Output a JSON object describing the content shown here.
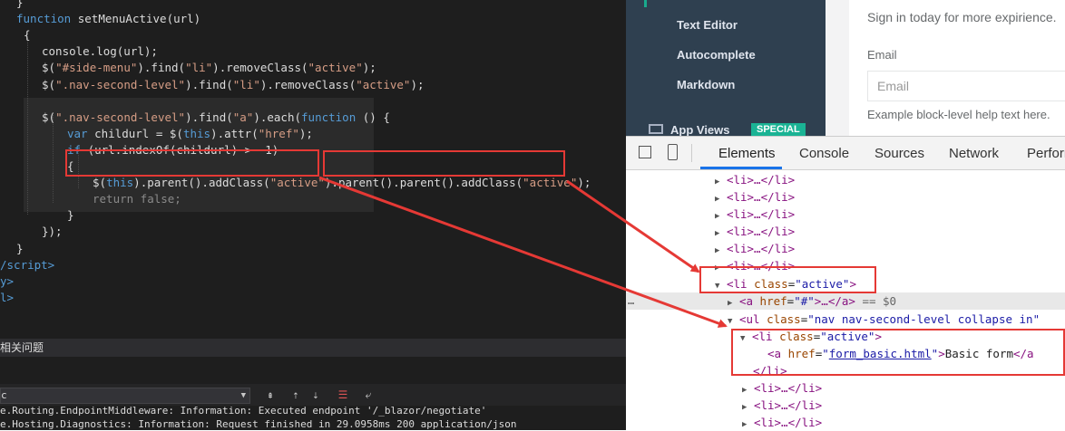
{
  "editor": {
    "code_lines": [
      {
        "indent": 18,
        "parts": [
          {
            "t": "}",
            "c": ""
          }
        ]
      },
      {
        "indent": 18,
        "parts": [
          {
            "t": "function",
            "c": "kw"
          },
          {
            "t": " setMenuActive(url)",
            "c": ""
          }
        ]
      },
      {
        "indent": 26,
        "parts": [
          {
            "t": "{",
            "c": ""
          }
        ]
      },
      {
        "indent": 46,
        "parts": [
          {
            "t": "console.log(url);",
            "c": ""
          }
        ]
      },
      {
        "indent": 46,
        "parts": [
          {
            "t": "$(",
            "c": ""
          },
          {
            "t": "\"#side-menu\"",
            "c": "str"
          },
          {
            "t": ").find(",
            "c": ""
          },
          {
            "t": "\"li\"",
            "c": "str"
          },
          {
            "t": ").removeClass(",
            "c": ""
          },
          {
            "t": "\"active\"",
            "c": "str"
          },
          {
            "t": ");",
            "c": ""
          }
        ]
      },
      {
        "indent": 46,
        "parts": [
          {
            "t": "$(",
            "c": ""
          },
          {
            "t": "\".nav-second-level\"",
            "c": "str"
          },
          {
            "t": ").find(",
            "c": ""
          },
          {
            "t": "\"li\"",
            "c": "str"
          },
          {
            "t": ").removeClass(",
            "c": ""
          },
          {
            "t": "\"active\"",
            "c": "str"
          },
          {
            "t": ");",
            "c": ""
          }
        ]
      },
      {
        "indent": 46,
        "parts": []
      },
      {
        "indent": 46,
        "parts": [
          {
            "t": "$(",
            "c": ""
          },
          {
            "t": "\".nav-second-level\"",
            "c": "str"
          },
          {
            "t": ").find(",
            "c": ""
          },
          {
            "t": "\"a\"",
            "c": "str"
          },
          {
            "t": ").each(",
            "c": ""
          },
          {
            "t": "function",
            "c": "kw"
          },
          {
            "t": " () {",
            "c": ""
          }
        ]
      },
      {
        "indent": 74,
        "parts": [
          {
            "t": "var",
            "c": "kw"
          },
          {
            "t": " childurl = $(",
            "c": ""
          },
          {
            "t": "this",
            "c": "kw"
          },
          {
            "t": ").attr(",
            "c": ""
          },
          {
            "t": "\"href\"",
            "c": "str"
          },
          {
            "t": ");",
            "c": ""
          }
        ]
      },
      {
        "indent": 74,
        "parts": [
          {
            "t": "if",
            "c": "kw"
          },
          {
            "t": " (url.indexOf(childurl) > -1)",
            "c": ""
          }
        ]
      },
      {
        "indent": 74,
        "parts": [
          {
            "t": "{",
            "c": ""
          }
        ]
      },
      {
        "indent": 102,
        "parts": [
          {
            "t": "$(",
            "c": ""
          },
          {
            "t": "this",
            "c": "kw"
          },
          {
            "t": ").parent().addClass(",
            "c": ""
          },
          {
            "t": "\"active\"",
            "c": "str"
          },
          {
            "t": ").parent().parent().addClass(",
            "c": ""
          },
          {
            "t": "\"active\"",
            "c": "str"
          },
          {
            "t": ");",
            "c": ""
          }
        ]
      },
      {
        "indent": 102,
        "parts": [
          {
            "t": "return false;",
            "c": "gray"
          }
        ]
      },
      {
        "indent": 74,
        "parts": [
          {
            "t": "}",
            "c": ""
          }
        ]
      },
      {
        "indent": 46,
        "parts": [
          {
            "t": "});",
            "c": ""
          }
        ]
      },
      {
        "indent": 18,
        "parts": [
          {
            "t": "}",
            "c": ""
          }
        ]
      },
      {
        "indent": 0,
        "parts": [
          {
            "t": "/script>",
            "c": "kw"
          }
        ]
      },
      {
        "indent": 0,
        "parts": [
          {
            "t": "y>",
            "c": "kw"
          }
        ]
      },
      {
        "indent": 0,
        "parts": [
          {
            "t": "l>",
            "c": "kw"
          }
        ]
      }
    ],
    "panel_title": "相关问题",
    "dropdown_value": "c",
    "output_lines": [
      "e.Routing.EndpointMiddleware: Information: Executed endpoint '/_blazor/negotiate'",
      "e.Hosting.Diagnostics: Information: Request finished in 29.0958ms 200 application/json"
    ]
  },
  "site": {
    "sidebar_items": [
      "Text Editor",
      "Autocomplete",
      "Markdown",
      "App Views"
    ],
    "special_badge": "SPECIAL",
    "signin_text": "Sign in today for more expirience.",
    "email_label": "Email",
    "email_placeholder": "Email",
    "help_text": "Example block-level help text here."
  },
  "devtools": {
    "tabs": [
      "Elements",
      "Console",
      "Sources",
      "Network",
      "Perform"
    ],
    "active_tab": "Elements",
    "collapsed_li": "<li>…</li>",
    "li_active": {
      "tag_open": "<li",
      "attr": "class",
      "val": "\"active\"",
      "close": ">"
    },
    "a_hash": {
      "attr": "href",
      "val": "\"#\"",
      "rest": ">…</a>",
      "eq": " == $0"
    },
    "ul_line": {
      "attr": "class",
      "val": "\"nav nav-second-level collapse in\""
    },
    "inner_li": {
      "attr": "class",
      "val": "\"active\""
    },
    "form_link": {
      "attr": "href",
      "val": "form_basic.html",
      "text": "Basic form"
    },
    "close_li": "</li>"
  },
  "colors": {
    "accent_red": "#e53935",
    "devtools_blue": "#1a73e8",
    "sidebar_bg": "#2f4050",
    "badge_green": "#1ab394"
  }
}
